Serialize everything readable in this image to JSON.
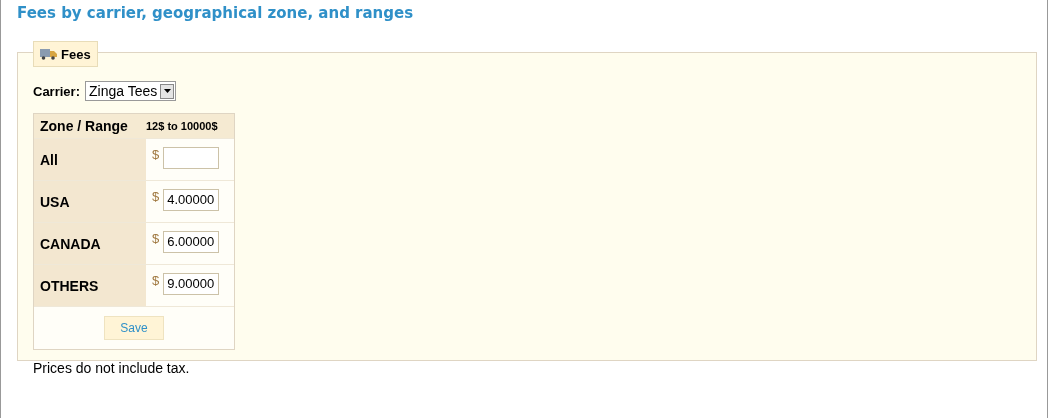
{
  "title": "Fees by carrier, geographical zone, and ranges",
  "panel": {
    "legend": "Fees",
    "carrier_label": "Carrier:",
    "carrier_value": "Zinga Tees",
    "table": {
      "columns": [
        "Zone / Range",
        "12$ to 10000$"
      ],
      "rows": [
        {
          "zone": "All",
          "currency": "$",
          "value": ""
        },
        {
          "zone": "USA",
          "currency": "$",
          "value": "4.00000"
        },
        {
          "zone": "CANADA",
          "currency": "$",
          "value": "6.00000"
        },
        {
          "zone": "OTHERS",
          "currency": "$",
          "value": "9.00000"
        }
      ]
    },
    "save": "Save",
    "note": "Prices do not include tax."
  }
}
